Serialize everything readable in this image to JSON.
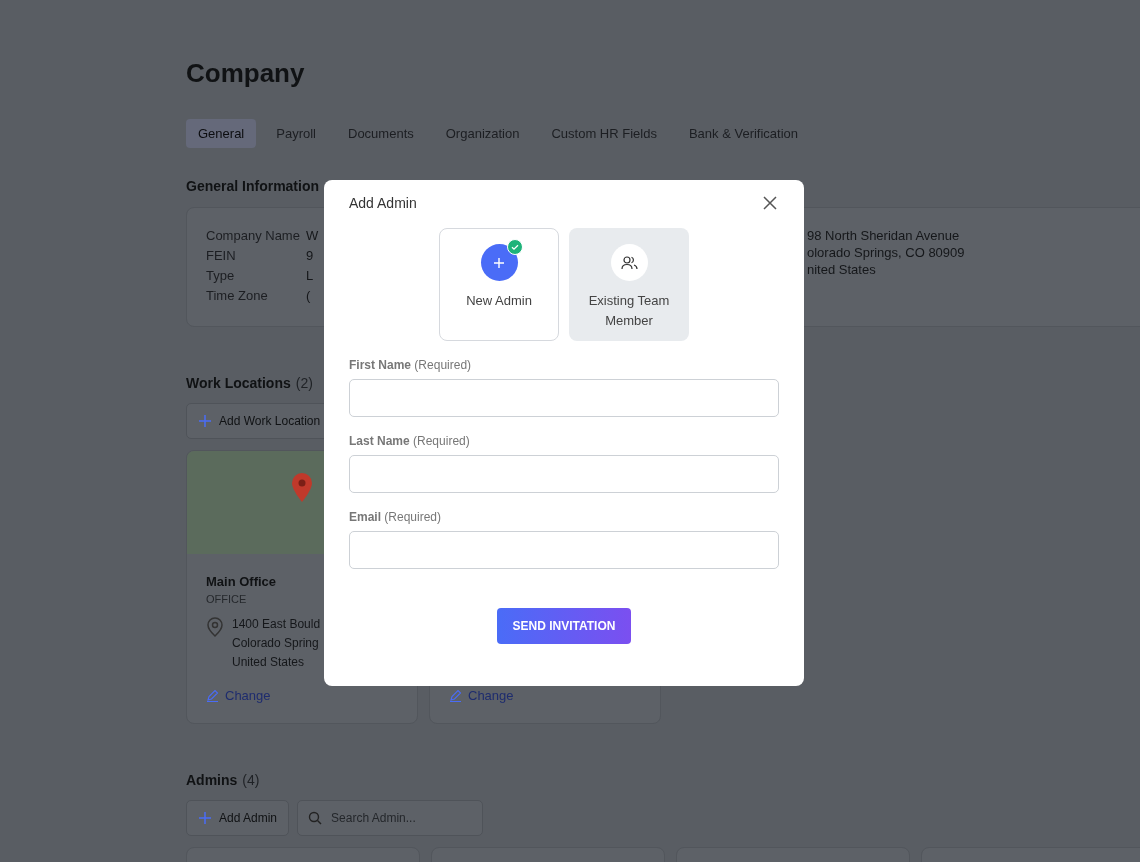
{
  "page": {
    "title": "Company"
  },
  "tabs": [
    {
      "label": "General",
      "selected": true
    },
    {
      "label": "Payroll",
      "selected": false
    },
    {
      "label": "Documents",
      "selected": false
    },
    {
      "label": "Organization",
      "selected": false
    },
    {
      "label": "Custom HR Fields",
      "selected": false
    },
    {
      "label": "Bank & Verification",
      "selected": false
    }
  ],
  "general_information": {
    "heading": "General Information",
    "fields": [
      {
        "label": "Company Name",
        "value": "W"
      },
      {
        "label": "FEIN",
        "value": "9"
      },
      {
        "label": "Type",
        "value": "L"
      },
      {
        "label": "Time Zone",
        "value": "("
      }
    ],
    "address": [
      "98 North Sheridan Avenue",
      "olorado Springs, CO 80909",
      "nited States"
    ]
  },
  "work_locations": {
    "heading": "Work Locations",
    "count": "(2)",
    "add_button": "Add Work Location",
    "cards": [
      {
        "name": "Main Office",
        "type": "OFFICE",
        "address": [
          "1400 East Bould",
          "Colorado Spring",
          "United States"
        ],
        "change": "Change"
      },
      {
        "change": "Change"
      }
    ]
  },
  "admins": {
    "heading": "Admins",
    "count": "(4)",
    "add_button": "Add Admin",
    "search": {
      "placeholder": "Search Admin..."
    }
  },
  "modal": {
    "title": "Add Admin",
    "options": [
      {
        "kind": "new",
        "label": "New Admin",
        "selected": true
      },
      {
        "kind": "existing",
        "label": "Existing Team Member",
        "selected": false
      }
    ],
    "fields": [
      {
        "label": "First Name",
        "hint": "(Required)"
      },
      {
        "label": "Last Name",
        "hint": "(Required)"
      },
      {
        "label": "Email",
        "hint": "(Required)"
      }
    ],
    "submit": "SEND INVITATION"
  }
}
